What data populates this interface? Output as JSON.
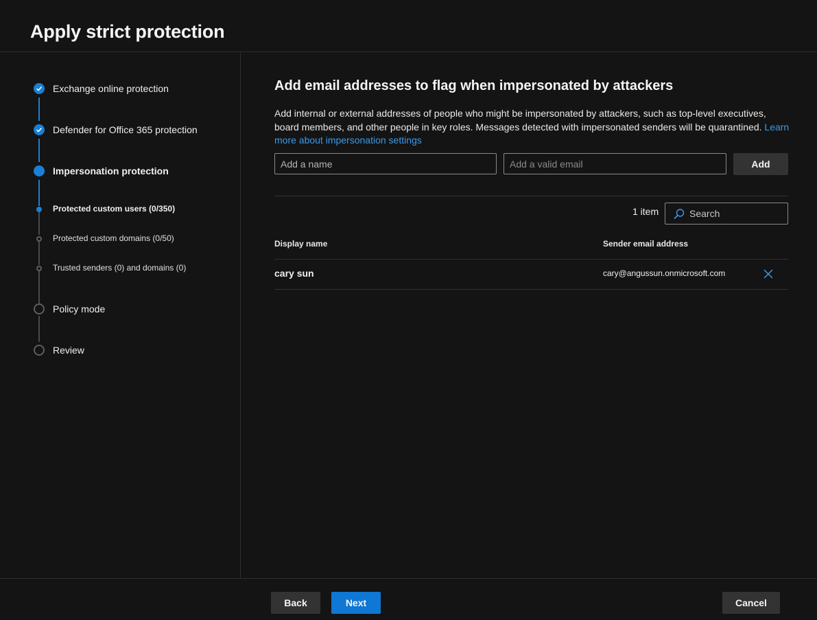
{
  "header": {
    "title": "Apply strict protection"
  },
  "colors": {
    "accent": "#0f78d4",
    "link": "#3b9aec",
    "background": "#141414"
  },
  "steps": [
    {
      "label": "Exchange online protection",
      "state": "completed",
      "icon": "checkmark-icon"
    },
    {
      "label": "Defender for Office 365 protection",
      "state": "completed",
      "icon": "checkmark-icon"
    },
    {
      "label": "Impersonation protection",
      "state": "current"
    },
    {
      "label": "Protected custom users (0/350)",
      "state": "current-substep"
    },
    {
      "label": "Protected custom domains (0/50)",
      "state": "pending-substep"
    },
    {
      "label": "Trusted senders (0) and domains (0)",
      "state": "pending-substep"
    },
    {
      "label": "Policy mode",
      "state": "pending"
    },
    {
      "label": "Review",
      "state": "pending"
    }
  ],
  "main": {
    "title": "Add email addresses to flag when impersonated by attackers",
    "description": "Add internal or external addresses of people who might be impersonated by attackers, such as top-level executives, board members, and other people in key roles. Messages detected with impersonated senders will be quarantined. ",
    "learn_more_link": "Learn more about impersonation settings",
    "name_input": {
      "placeholder": "Add a name",
      "value": ""
    },
    "email_input": {
      "placeholder": "Add a valid email",
      "value": ""
    },
    "add_button": "Add",
    "item_count": "1 item",
    "search": {
      "placeholder": "Search",
      "icon": "search-icon"
    },
    "table": {
      "columns": [
        "Display name",
        "Sender email address"
      ],
      "rows": [
        {
          "display_name": "cary sun",
          "email": "cary@angussun.onmicrosoft.com",
          "action_icon": "close-icon"
        }
      ]
    }
  },
  "footer": {
    "back": "Back",
    "next": "Next",
    "cancel": "Cancel"
  }
}
